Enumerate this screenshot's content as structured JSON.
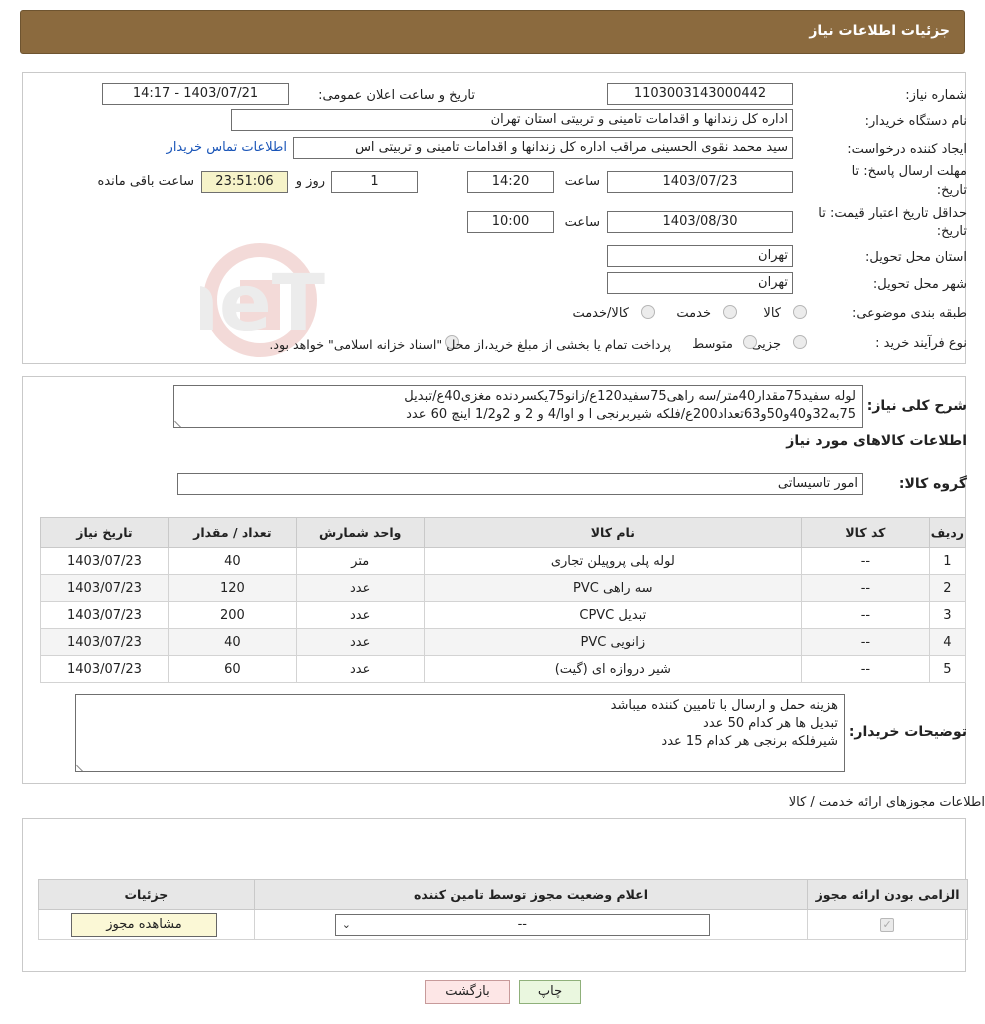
{
  "header": {
    "title": "جزئیات اطلاعات نیاز"
  },
  "form": {
    "need_number_label": "شماره نیاز:",
    "need_number": "1103003143000442",
    "announce_label": "تاریخ و ساعت اعلان عمومی:",
    "announce_value": "1403/07/21 - 14:17",
    "buyer_org_label": "نام دستگاه خریدار:",
    "buyer_org": "اداره کل زندانها و اقدامات تامینی و تربیتی استان تهران",
    "creator_label": "ایجاد کننده درخواست:",
    "creator": "سید محمد نقوی الحسینی مراقب  اداره کل زندانها و اقدامات تامینی و تربیتی اس",
    "contact_link": "اطلاعات تماس خریدار",
    "deadline_label_1": "مهلت ارسال پاسخ: تا",
    "deadline_label_2": "تاریخ:",
    "deadline_date": "1403/07/23",
    "time_label": "ساعت",
    "deadline_time": "14:20",
    "days_value": "1",
    "days_label": "روز و",
    "remaining_time": "23:51:06",
    "remaining_label": "ساعت باقی مانده",
    "validity_label_1": "حداقل تاریخ اعتبار قیمت: تا",
    "validity_label_2": "تاریخ:",
    "validity_date": "1403/08/30",
    "validity_time": "10:00",
    "province_label": "استان محل تحویل:",
    "province": "تهران",
    "city_label": "شهر محل تحویل:",
    "city": "تهران",
    "category_label": "طبقه بندی موضوعی:",
    "category_options": [
      "کالا",
      "خدمت",
      "کالا/خدمت"
    ],
    "process_label": "نوع فرآیند خرید :",
    "process_options": [
      "جزیی",
      "متوسط"
    ],
    "process_note": "پرداخت تمام یا بخشی از مبلغ خرید،از محل \"اسناد خزانه اسلامی\" خواهد بود."
  },
  "watermark": {
    "text": "AriaTender.neT"
  },
  "description": {
    "label": "شرح کلی نیاز:",
    "line1": "لوله سفید75مقدار40متر/سه راهی75سفید120ع/زانو75یکسردنده مغزی40ع/تبدیل",
    "line2": "75به32و40و50و63تعداد200ع/فلکه شیربرنجی ا و اوا/4 و 2 و 2و1/2 اینچ 60 عدد"
  },
  "goods": {
    "title": "اطلاعات کالاهای مورد نیاز",
    "group_label": "گروه کالا:",
    "group_value": "امور تاسیساتی",
    "columns": [
      "ردیف",
      "کد کالا",
      "نام کالا",
      "واحد شمارش",
      "تعداد / مقدار",
      "تاریخ نیاز"
    ],
    "rows": [
      [
        "1",
        "--",
        "لوله پلی پروپیلن تجاری",
        "متر",
        "40",
        "1403/07/23"
      ],
      [
        "2",
        "--",
        "سه راهی PVC",
        "عدد",
        "120",
        "1403/07/23"
      ],
      [
        "3",
        "--",
        "تبدیل CPVC",
        "عدد",
        "200",
        "1403/07/23"
      ],
      [
        "4",
        "--",
        "زانویی PVC",
        "عدد",
        "40",
        "1403/07/23"
      ],
      [
        "5",
        "--",
        "شیر دروازه ای (گیت)",
        "عدد",
        "60",
        "1403/07/23"
      ]
    ]
  },
  "buyer_notes": {
    "label": "توضیحات خریدار:",
    "lines": [
      "هزینه حمل و ارسال با تامیین کننده میباشد",
      "تبدیل ها هر کدام 50 عدد",
      "شیرفلکه برنجی هر کدام 15 عدد"
    ]
  },
  "permits": {
    "title": "اطلاعات مجوزهای ارائه خدمت / کالا",
    "columns": [
      "الزامی بودن ارائه مجوز",
      "اعلام وضعیت مجوز توسط تامین کننده",
      "جزئیات"
    ],
    "select_value": "--",
    "view_button": "مشاهده مجوز"
  },
  "actions": {
    "print": "چاپ",
    "back": "بازگشت"
  }
}
